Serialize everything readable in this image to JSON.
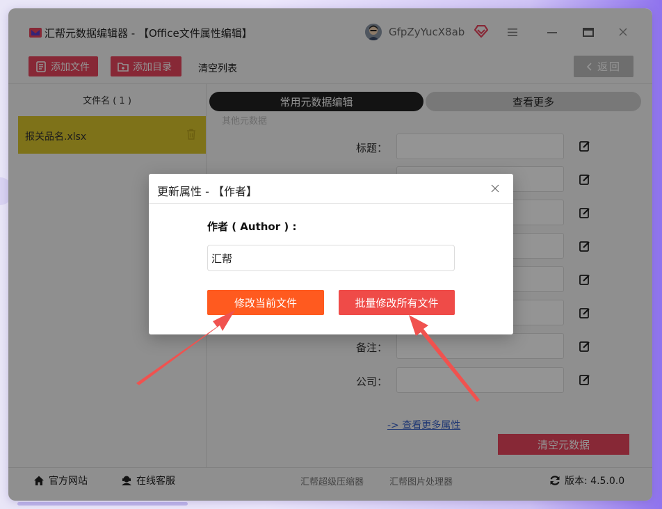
{
  "window": {
    "title": "汇帮元数据编辑器 - 【Office文件属性编辑】",
    "username": "GfpZyYucX8ab"
  },
  "toolbar": {
    "add_file": "添加文件",
    "add_dir": "添加目录",
    "clear_list": "清空列表",
    "back": "返回"
  },
  "file_list": {
    "header": "文件名 ( 1 )",
    "files": [
      {
        "name": "报关品名.xlsx"
      }
    ]
  },
  "tabs": {
    "common": "常用元数据编辑",
    "more": "查看更多"
  },
  "section_label": "其他元数据",
  "fields": [
    {
      "label": "标题：",
      "value": ""
    },
    {
      "label": "",
      "value": ""
    },
    {
      "label": "",
      "value": ""
    },
    {
      "label": "",
      "value": ""
    },
    {
      "label": "",
      "value": ""
    },
    {
      "label": "",
      "value": ""
    },
    {
      "label": "备注：",
      "value": ""
    },
    {
      "label": "公司：",
      "value": ""
    }
  ],
  "more_attrs_link": "-> 查看更多属性",
  "clear_meta": "清空元数据",
  "footer": {
    "website": "官方网站",
    "service": "在线客服",
    "link1": "汇帮超级压缩器",
    "link2": "汇帮图片处理器",
    "version": "版本: 4.5.0.0"
  },
  "dialog": {
    "title": "更新属性 - 【作者】",
    "label": "作者 ( Author ) :",
    "value": "汇帮",
    "btn_current": "修改当前文件",
    "btn_all": "批量修改所有文件"
  },
  "colors": {
    "accent_red": "#e8465e",
    "orange": "#ff5a1f",
    "selected_row": "#d9c42c",
    "arrow": "#f0524f"
  }
}
